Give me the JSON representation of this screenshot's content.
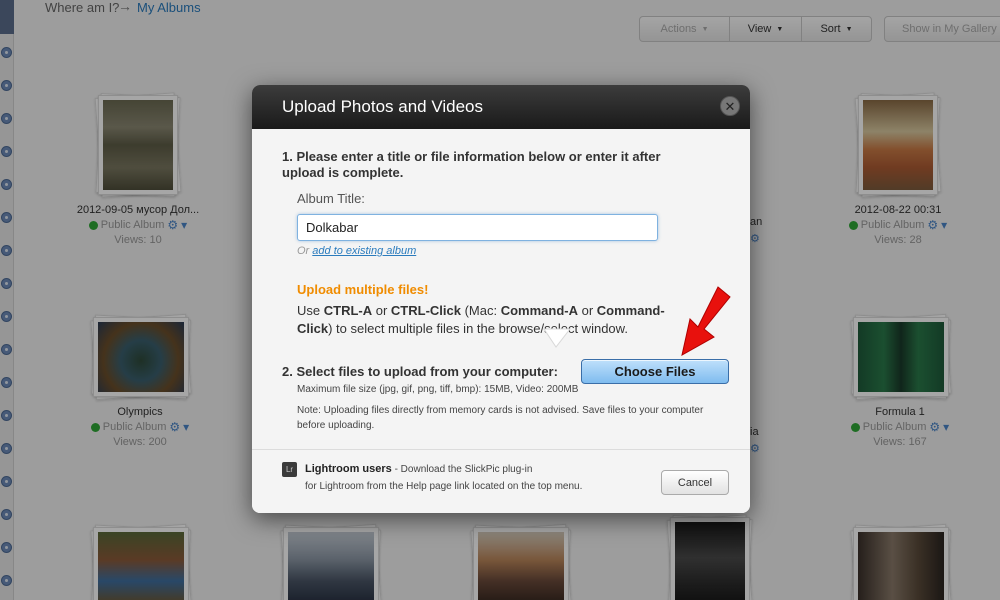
{
  "header": {
    "where_label": "Where am I?",
    "arrow": "→",
    "albums_link": "My Albums"
  },
  "toolbar": {
    "actions": "Actions",
    "view": "View",
    "sort": "Sort",
    "gallery": "Show in My Gallery",
    "caret": "▼"
  },
  "albums": [
    {
      "title": "2012-09-05 мусор Дол...",
      "status": "Public Album",
      "views": "Views: 10"
    },
    {
      "title": "2012-08-22 00:31",
      "status": "Public Album",
      "views": "Views: 28"
    },
    {
      "title": "Olympics",
      "status": "Public Album",
      "views": "Views: 200"
    },
    {
      "title": "Formula 1",
      "status": "Public Album",
      "views": "Views: 167"
    }
  ],
  "partials": {
    "an": "an",
    "ia": "ia"
  },
  "modal": {
    "title": "Upload Photos and Videos",
    "close": "✕",
    "step1": "1. Please enter a title or file information below or enter it after upload is complete.",
    "album_title_label": "Album Title:",
    "album_title_value": "Dolkabar",
    "or_text": "Or",
    "existing_link": "add to existing album",
    "multi_heading": "Upload multiple files!",
    "multi_use": "Use ",
    "ctrl_a": "CTRL-A",
    "or_word": " or ",
    "ctrl_click": "CTRL-Click",
    "mac": " (Mac: ",
    "cmd_a": "Command-A",
    "or_word2": " or ",
    "cmd_click": "Command-Click",
    "multi_rest": ") to select multiple files in the browse/select window.",
    "step2": "2. Select files to upload from your computer:",
    "choose_files": "Choose Files",
    "max_size": "Maximum file size (jpg, gif, png, tiff, bmp): 15MB, Video: 200MB",
    "note": "Note: Uploading files directly from memory cards is not advised. Save files to your computer before uploading.",
    "lr_icon": "Lr",
    "lr_title": "Lightroom users",
    "lr_line1_rest": " - Download the SlickPic plug-in",
    "lr_line2": "for Lightroom from the Help page link located on the top menu.",
    "cancel": "Cancel"
  },
  "icons": {
    "gear": "⚙",
    "dropdown": "▾"
  }
}
